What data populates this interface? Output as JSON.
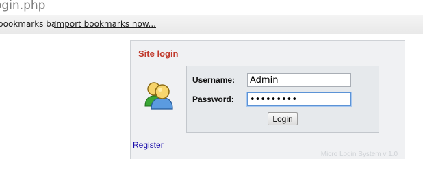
{
  "browser": {
    "address_text": "ogin.php",
    "bookmarks_bar_text": "bookmarks bar.",
    "import_bookmarks_link": "Import bookmarks now..."
  },
  "login_box": {
    "title": "Site login",
    "username_label": "Username:",
    "username_value": "Admin",
    "password_label": "Password:",
    "password_value": "•••••••••",
    "login_button": "Login",
    "register_link": "Register",
    "version_text": "Micro Login System v 1.0",
    "title_color": "#c0392b",
    "link_color": "#1a0dab"
  },
  "icons": {
    "user_icon": "user-group-icon"
  }
}
